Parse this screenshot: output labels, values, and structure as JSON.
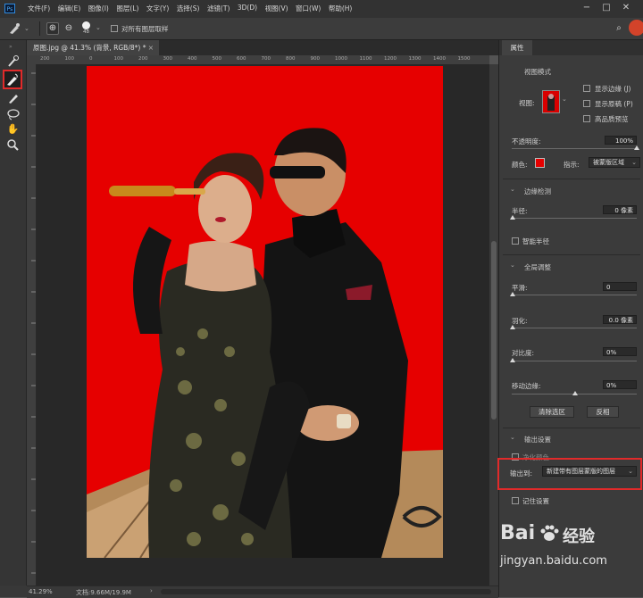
{
  "menubar": {
    "app_icon": "Ps",
    "items": [
      "文件(F)",
      "编辑(E)",
      "图像(I)",
      "图层(L)",
      "文字(Y)",
      "选择(S)",
      "滤镜(T)",
      "3D(D)",
      "视图(V)",
      "窗口(W)",
      "帮助(H)"
    ]
  },
  "options": {
    "brush_size": "48",
    "sample_all_layers": "对所有图层取样"
  },
  "document": {
    "tab_title": "原图.jpg @ 41.3% (背景, RGB/8*) *",
    "ruler_ticks": [
      "200",
      "100",
      "0",
      "100",
      "200",
      "300",
      "400",
      "500",
      "600",
      "700",
      "800",
      "900",
      "1000",
      "1100",
      "1200",
      "1300",
      "1400",
      "1500"
    ]
  },
  "status": {
    "zoom": "41.29%",
    "doc_info": "文档:9.66M/19.9M"
  },
  "properties": {
    "tab": "属性",
    "view_mode_title": "视图模式",
    "view_label": "视图:",
    "show_edges": "显示边缘 (J)",
    "show_original": "显示原稿 (P)",
    "high_quality": "高品质预览",
    "opacity_label": "不透明度:",
    "opacity_value": "100%",
    "color_label": "颜色:",
    "overlay_color": "#e60000",
    "indicate_label": "指示:",
    "indicate_value": "被蒙版区域",
    "edge_detection": "边缘检测",
    "radius_label": "半径:",
    "radius_value": "0 像素",
    "smart_radius": "智能半径",
    "global_refine": "全局调整",
    "smooth_label": "平滑:",
    "smooth_value": "0",
    "feather_label": "羽化:",
    "feather_value": "0.0 像素",
    "contrast_label": "对比度:",
    "contrast_value": "0%",
    "shift_label": "移动边缘:",
    "shift_value": "0%",
    "clear_selection": "清除选区",
    "invert": "反相",
    "output_settings": "输出设置",
    "decontaminate": "净化颜色",
    "output_to_label": "输出到:",
    "output_to_value": "新建带有图层蒙版的图层",
    "remember": "记住设置"
  },
  "watermark": {
    "brand": "Bai",
    "brand2": "经验",
    "url": "jingyan.baidu.com"
  }
}
